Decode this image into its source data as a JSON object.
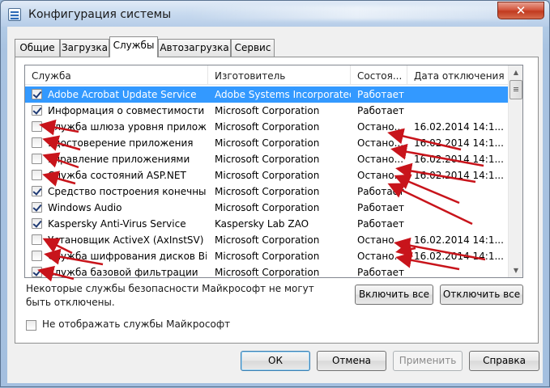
{
  "window": {
    "title": "Конфигурация системы",
    "close_glyph": "✕"
  },
  "tabs": [
    {
      "label": "Общие"
    },
    {
      "label": "Загрузка"
    },
    {
      "label": "Службы"
    },
    {
      "label": "Автозагрузка"
    },
    {
      "label": "Сервис"
    }
  ],
  "columns": {
    "service": "Служба",
    "manufacturer": "Изготовитель",
    "status": "Состоя...",
    "date": "Дата отключения"
  },
  "services": [
    {
      "checked": true,
      "name": "Adobe Acrobat Update Service",
      "manufacturer": "Adobe Systems Incorporated",
      "status": "Работает",
      "date": "",
      "selected": true
    },
    {
      "checked": true,
      "name": "Информация о совместимости ...",
      "manufacturer": "Microsoft Corporation",
      "status": "Работает",
      "date": ""
    },
    {
      "checked": false,
      "name": "Служба шлюза уровня прилож...",
      "manufacturer": "Microsoft Corporation",
      "status": "Остано...",
      "date": "16.02.2014 14:1..."
    },
    {
      "checked": false,
      "name": "Удостоверение приложения",
      "manufacturer": "Microsoft Corporation",
      "status": "Остано...",
      "date": "16.02.2014 14:1..."
    },
    {
      "checked": false,
      "name": "Управление приложениями",
      "manufacturer": "Microsoft Corporation",
      "status": "Остано...",
      "date": "16.02.2014 14:1..."
    },
    {
      "checked": false,
      "name": "Служба состояний ASP.NET",
      "manufacturer": "Microsoft Corporation",
      "status": "Остано...",
      "date": "16.02.2014 14:1..."
    },
    {
      "checked": true,
      "name": "Средство построения конечны...",
      "manufacturer": "Microsoft Corporation",
      "status": "Работает",
      "date": ""
    },
    {
      "checked": true,
      "name": "Windows Audio",
      "manufacturer": "Microsoft Corporation",
      "status": "Работает",
      "date": ""
    },
    {
      "checked": true,
      "name": "Kaspersky Anti-Virus Service",
      "manufacturer": "Kaspersky Lab ZAO",
      "status": "Работает",
      "date": ""
    },
    {
      "checked": false,
      "name": "Установщик ActiveX (AxInstSV)",
      "manufacturer": "Microsoft Corporation",
      "status": "Остано...",
      "date": "16.02.2014 14:1..."
    },
    {
      "checked": false,
      "name": "Служба шифрования дисков Bi...",
      "manufacturer": "Microsoft Corporation",
      "status": "Остано...",
      "date": "16.02.2014 14:1..."
    },
    {
      "checked": true,
      "name": "Служба базовой фильтрации",
      "manufacturer": "Microsoft Corporation",
      "status": "Работает",
      "date": ""
    }
  ],
  "scrollbar": {
    "up_glyph": "▲",
    "down_glyph": "▼"
  },
  "note": "Некоторые службы безопасности Майкрософт не могут быть отключены.",
  "buttons": {
    "enable_all": "Включить все",
    "disable_all": "Отключить все",
    "ok": "ОК",
    "cancel": "Отмена",
    "apply": "Применить",
    "help": "Справка"
  },
  "hide_ms_label": "Не отображать службы Майкрософт",
  "colors": {
    "annotation_arrow": "#c8141b",
    "selection": "#3399ff"
  }
}
